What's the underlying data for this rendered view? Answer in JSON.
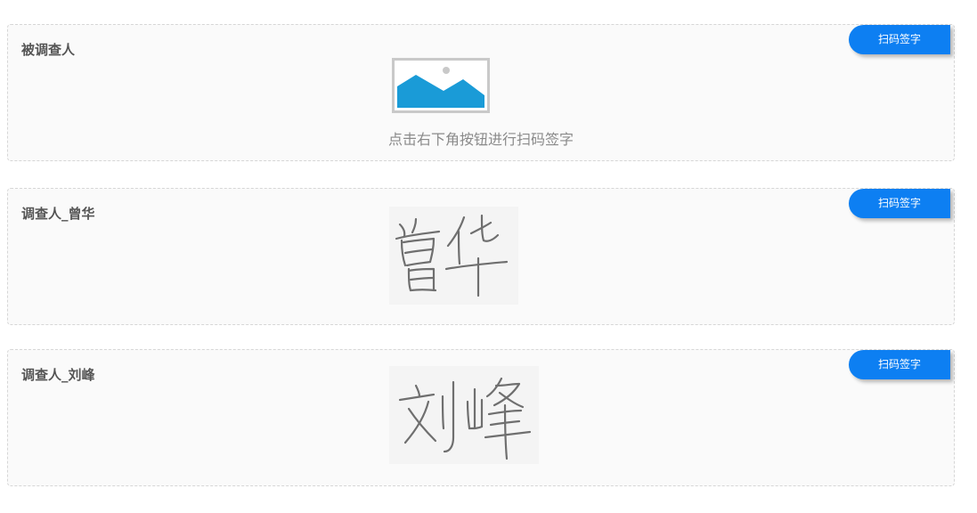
{
  "cards": [
    {
      "label": "被调查人",
      "button_label": "扫码签字",
      "placeholder_text": "点击右下角按钮进行扫码签字",
      "placeholder_icon": "image-placeholder-icon"
    },
    {
      "label": "调查人_曾华",
      "button_label": "扫码签字",
      "signature": "曾华"
    },
    {
      "label": "调查人_刘峰",
      "button_label": "扫码签字",
      "signature": "刘峰"
    }
  ],
  "colors": {
    "button": "#0d7ff2",
    "card_background": "#fafafa",
    "card_border": "#d6d6d6",
    "label": "#555555",
    "placeholder_text": "#8a8a8a",
    "image_icon_blue": "#1a9bd7"
  }
}
